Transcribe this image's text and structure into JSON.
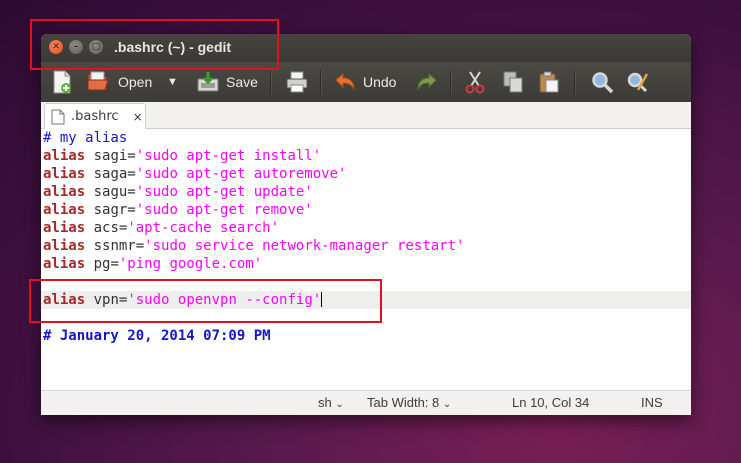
{
  "window": {
    "title": ".bashrc (~) - gedit"
  },
  "toolbar": {
    "new_icon": "new-document-icon",
    "open_label": "Open",
    "save_label": "Save",
    "print_icon": "print-icon",
    "undo_label": "Undo",
    "redo_icon": "redo-icon",
    "cut_icon": "cut-icon",
    "copy_icon": "copy-icon",
    "paste_icon": "paste-icon",
    "find_icon": "search-icon",
    "replace_icon": "find-replace-icon"
  },
  "tabs": [
    {
      "label": ".bashrc",
      "close": "×"
    }
  ],
  "editor": {
    "comment1": "# my alias",
    "aliases": [
      {
        "kw": "alias",
        "name": " sagi=",
        "value": "'sudo apt-get install'"
      },
      {
        "kw": "alias",
        "name": " saga=",
        "value": "'sudo apt-get autoremove'"
      },
      {
        "kw": "alias",
        "name": " sagu=",
        "value": "'sudo apt-get update'"
      },
      {
        "kw": "alias",
        "name": " sagr=",
        "value": "'sudo apt-get remove'"
      },
      {
        "kw": "alias",
        "name": " acs=",
        "value": "'apt-cache search'"
      },
      {
        "kw": "alias",
        "name": " ssnmr=",
        "value": "'sudo service network-manager restart'"
      },
      {
        "kw": "alias",
        "name": " pg=",
        "value": "'ping google.com'"
      }
    ],
    "vpn": {
      "kw": "alias",
      "name": " vpn=",
      "value": "'sudo openvpn --config'"
    },
    "comment2": "# January 20, 2014 07:09 PM"
  },
  "statusbar": {
    "language": "sh",
    "tab_width": "Tab Width: 8",
    "position": "Ln 10, Col 34",
    "mode": "INS"
  },
  "colors": {
    "keyword": "#a52a2a",
    "string": "#ff00ff",
    "comment": "#1515cc",
    "highlight_box": "#e1101f"
  }
}
